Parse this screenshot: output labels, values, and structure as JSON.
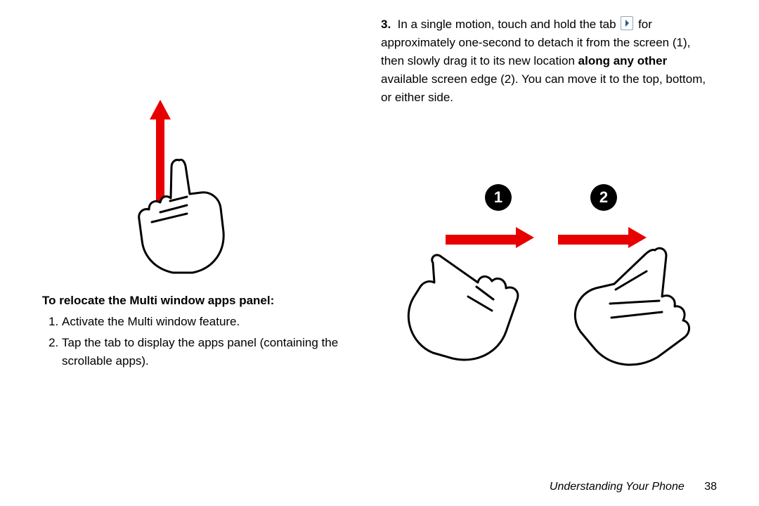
{
  "left": {
    "heading": "To relocate the Multi window apps panel:",
    "steps": [
      "Activate the Multi window feature.",
      "Tap the tab to display the apps panel (containing the scrollable apps)."
    ]
  },
  "right": {
    "step3_parts": {
      "prefix": "In a single motion, touch and hold the tab",
      "after_icon": "for approximately one-second to detach it from the screen (1), then slowly drag it to its new location",
      "bold": "along any other",
      "suffix": "available screen edge (2). You can move it to the top, bottom, or either side."
    },
    "circles": {
      "one": "1",
      "two": "2"
    }
  },
  "footer": {
    "section": "Understanding Your Phone",
    "page": "38"
  }
}
